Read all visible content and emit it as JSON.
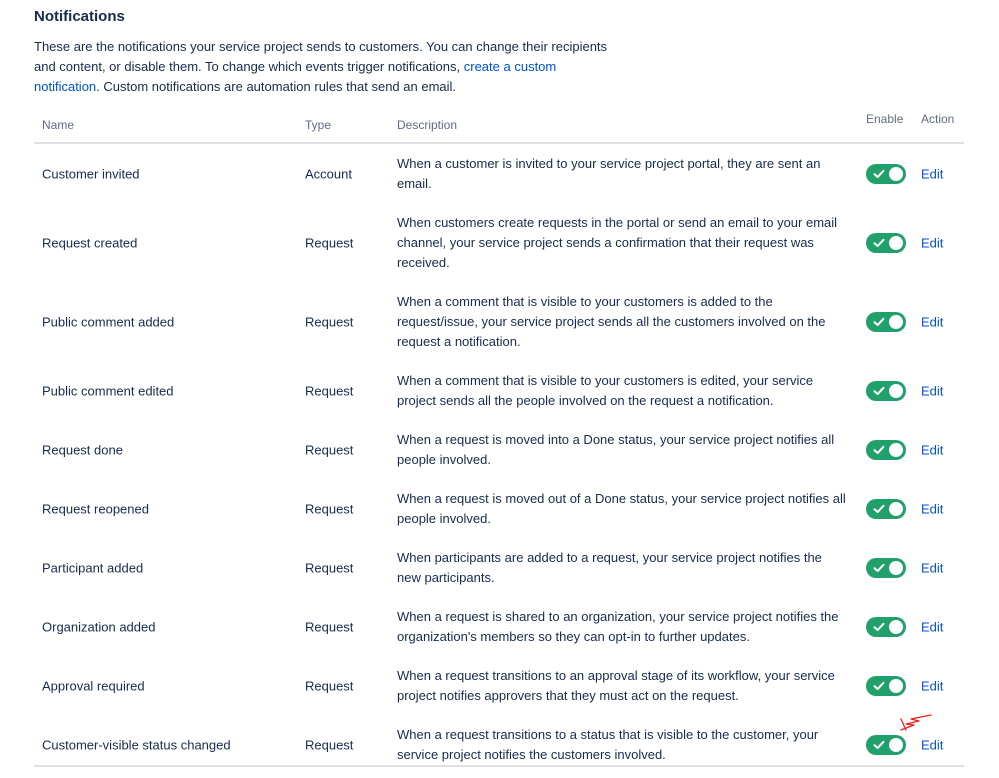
{
  "header": {
    "title": "Notifications",
    "intro_before_link": "These are the notifications your service project sends to customers. You can change their recipients and content, or disable them. To change which events trigger notifications, ",
    "intro_link": "create a custom notification",
    "intro_after_link": ". Custom notifications are automation rules that send an email."
  },
  "columns": {
    "name": "Name",
    "type": "Type",
    "description": "Description",
    "enable": "Enable",
    "action": "Action"
  },
  "rows": [
    {
      "name": "Customer invited",
      "type": "Account",
      "description": "When a customer is invited to your service project portal, they are sent an email.",
      "enabled": true,
      "action": "Edit"
    },
    {
      "name": "Request created",
      "type": "Request",
      "description": "When customers create requests in the portal or send an email to your email channel, your service project sends a confirmation that their request was received.",
      "enabled": true,
      "action": "Edit"
    },
    {
      "name": "Public comment added",
      "type": "Request",
      "description": "When a comment that is visible to your customers is added to the request/issue, your service project sends all the customers involved on the request a notification.",
      "enabled": true,
      "action": "Edit"
    },
    {
      "name": "Public comment edited",
      "type": "Request",
      "description": "When a comment that is visible to your customers is edited, your service project sends all the people involved on the request a notification.",
      "enabled": true,
      "action": "Edit"
    },
    {
      "name": "Request done",
      "type": "Request",
      "description": "When a request is moved into a Done status, your service project notifies all people involved.",
      "enabled": true,
      "action": "Edit"
    },
    {
      "name": "Request reopened",
      "type": "Request",
      "description": "When a request is moved out of a Done status, your service project notifies all people involved.",
      "enabled": true,
      "action": "Edit"
    },
    {
      "name": "Participant added",
      "type": "Request",
      "description": "When participants are added to a request, your service project notifies the new participants.",
      "enabled": true,
      "action": "Edit"
    },
    {
      "name": "Organization added",
      "type": "Request",
      "description": "When a request is shared to an organization, your service project notifies the organization's members so they can opt-in to further updates.",
      "enabled": true,
      "action": "Edit"
    },
    {
      "name": "Approval required",
      "type": "Request",
      "description": "When a request transitions to an approval stage of its workflow, your service project notifies approvers that they must act on the request.",
      "enabled": true,
      "action": "Edit"
    },
    {
      "name": "Customer-visible status changed",
      "type": "Request",
      "description": "When a request transitions to a status that is visible to the customer, your service project notifies the customers involved.",
      "enabled": true,
      "action": "Edit"
    }
  ],
  "colors": {
    "toggle_on": "#22a06b",
    "link": "#0052cc",
    "annotation": "#e8201a"
  }
}
